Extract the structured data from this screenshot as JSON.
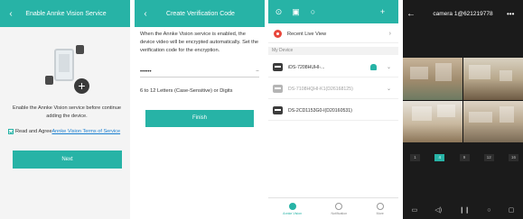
{
  "panel1": {
    "title": "Enable Annke Vision Service",
    "back_icon": "chevron-left-icon",
    "description": "Enable the Annke Vision service before continue adding the device.",
    "agree_prefix": "Read and Agree",
    "agree_link": "Annke Vision Terms of Service",
    "next_label": "Next",
    "accent": "#27b3a6"
  },
  "panel2": {
    "title": "Create Verification Code",
    "info": "When the Annke Vision service is enabled, the device video will be encrypted automatically. Set the verification code for the encryption.",
    "password_value": "••••••",
    "hint": "6 to 12 Letters (Case-Sensitive) or Digits",
    "finish_label": "Finish"
  },
  "panel3": {
    "recent_label": "Recent Live View",
    "section_label": "My Device",
    "devices": [
      {
        "name": "iDS-7208HUHI-...",
        "online": true
      },
      {
        "name": "DS-7108HQHI-K1(D26168125)",
        "online": false
      },
      {
        "name": "DS-2CD1153G0-I(D20160531)",
        "online": true
      }
    ],
    "tabs": [
      "Annke Vision",
      "Notification",
      "More"
    ]
  },
  "panel4": {
    "camera_name": "camera 1@621219778",
    "more_label": "•••",
    "pages": [
      "1",
      "4",
      "9",
      "12",
      "16"
    ],
    "active_page": "4",
    "controls": [
      "screen-size-icon",
      "speaker-icon",
      "pause-icon",
      "zoom-icon",
      "capture-icon"
    ]
  }
}
